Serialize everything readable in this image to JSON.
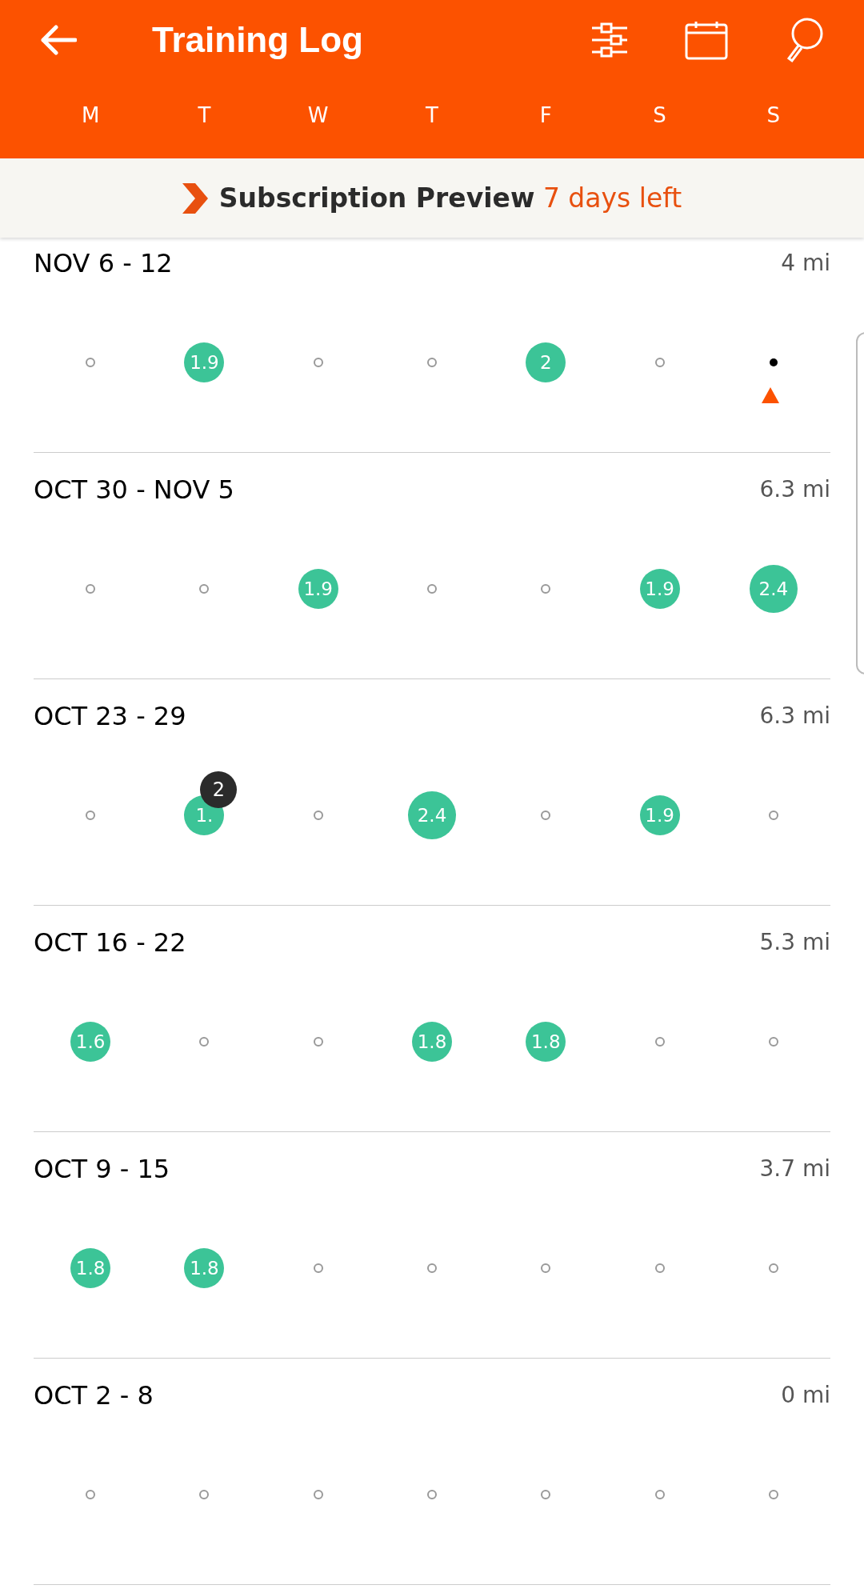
{
  "header": {
    "title": "Training Log",
    "weekdays": [
      "M",
      "T",
      "W",
      "T",
      "F",
      "S",
      "S"
    ]
  },
  "banner": {
    "title": "Subscription Preview",
    "note": "7 days left"
  },
  "weeks": [
    {
      "label": "NOV 6 - 12",
      "distance": "4 mi",
      "days": [
        {
          "kind": "rest"
        },
        {
          "kind": "run",
          "value": "1.9",
          "large": false
        },
        {
          "kind": "rest"
        },
        {
          "kind": "rest"
        },
        {
          "kind": "run",
          "value": "2",
          "large": false
        },
        {
          "kind": "rest"
        },
        {
          "kind": "today"
        }
      ]
    },
    {
      "label": "OCT 30 - NOV 5",
      "distance": "6.3 mi",
      "days": [
        {
          "kind": "rest"
        },
        {
          "kind": "rest"
        },
        {
          "kind": "run",
          "value": "1.9",
          "large": false
        },
        {
          "kind": "rest"
        },
        {
          "kind": "rest"
        },
        {
          "kind": "run",
          "value": "1.9",
          "large": false
        },
        {
          "kind": "run",
          "value": "2.4",
          "large": true
        }
      ]
    },
    {
      "label": "OCT 23 - 29",
      "distance": "6.3 mi",
      "days": [
        {
          "kind": "rest"
        },
        {
          "kind": "run",
          "value": "1.",
          "large": false,
          "badge": "2"
        },
        {
          "kind": "rest"
        },
        {
          "kind": "run",
          "value": "2.4",
          "large": true
        },
        {
          "kind": "rest"
        },
        {
          "kind": "run",
          "value": "1.9",
          "large": false
        },
        {
          "kind": "rest"
        }
      ]
    },
    {
      "label": "OCT 16 - 22",
      "distance": "5.3 mi",
      "days": [
        {
          "kind": "run",
          "value": "1.6",
          "large": false
        },
        {
          "kind": "rest"
        },
        {
          "kind": "rest"
        },
        {
          "kind": "run",
          "value": "1.8",
          "large": false
        },
        {
          "kind": "run",
          "value": "1.8",
          "large": false
        },
        {
          "kind": "rest"
        },
        {
          "kind": "rest"
        }
      ]
    },
    {
      "label": "OCT 9 - 15",
      "distance": "3.7 mi",
      "days": [
        {
          "kind": "run",
          "value": "1.8",
          "large": false
        },
        {
          "kind": "run",
          "value": "1.8",
          "large": false
        },
        {
          "kind": "rest"
        },
        {
          "kind": "rest"
        },
        {
          "kind": "rest"
        },
        {
          "kind": "rest"
        },
        {
          "kind": "rest"
        }
      ]
    },
    {
      "label": "OCT 2 - 8",
      "distance": "0 mi",
      "days": [
        {
          "kind": "rest"
        },
        {
          "kind": "rest"
        },
        {
          "kind": "rest"
        },
        {
          "kind": "rest"
        },
        {
          "kind": "rest"
        },
        {
          "kind": "rest"
        },
        {
          "kind": "rest"
        }
      ]
    }
  ]
}
